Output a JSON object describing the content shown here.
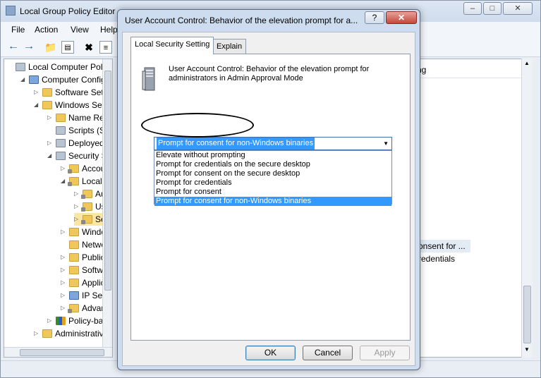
{
  "main_window": {
    "title": "Local Group Policy Editor",
    "menu": [
      "File",
      "Action",
      "View",
      "Help"
    ],
    "tree": [
      {
        "label": "Local Computer Polic",
        "icon": "computer-policy-icon",
        "indent": 0,
        "arrow": ""
      },
      {
        "label": "Computer Config",
        "icon": "computer-icon",
        "indent": 1,
        "arrow": "◢"
      },
      {
        "label": "Software Setti",
        "icon": "folder-icon",
        "indent": 2,
        "arrow": "▷"
      },
      {
        "label": "Windows Sett",
        "icon": "folder-icon",
        "indent": 2,
        "arrow": "◢"
      },
      {
        "label": "Name Res",
        "icon": "folder-icon",
        "indent": 3,
        "arrow": "▷"
      },
      {
        "label": "Scripts (Sta",
        "icon": "script-icon",
        "indent": 3,
        "arrow": ""
      },
      {
        "label": "Deployed",
        "icon": "printer-icon",
        "indent": 3,
        "arrow": "▷"
      },
      {
        "label": "Security Se",
        "icon": "security-icon",
        "indent": 3,
        "arrow": "◢"
      },
      {
        "label": "Accou",
        "icon": "lock-folder-icon",
        "indent": 4,
        "arrow": "▷"
      },
      {
        "label": "Local P",
        "icon": "lock-folder-icon",
        "indent": 4,
        "arrow": "◢"
      },
      {
        "label": "Au",
        "icon": "lock-folder-icon",
        "indent": 5,
        "arrow": "▷"
      },
      {
        "label": "Use",
        "icon": "lock-folder-icon",
        "indent": 5,
        "arrow": "▷"
      },
      {
        "label": "Sec",
        "icon": "lock-folder-icon",
        "indent": 5,
        "arrow": "▷"
      },
      {
        "label": "Windo",
        "icon": "folder-icon",
        "indent": 4,
        "arrow": "▷"
      },
      {
        "label": "Netwo",
        "icon": "folder-icon",
        "indent": 4,
        "arrow": ""
      },
      {
        "label": "Public",
        "icon": "folder-icon",
        "indent": 4,
        "arrow": "▷"
      },
      {
        "label": "Softwa",
        "icon": "folder-icon",
        "indent": 4,
        "arrow": "▷"
      },
      {
        "label": "Applic",
        "icon": "folder-icon",
        "indent": 4,
        "arrow": "▷"
      },
      {
        "label": "IP Secu",
        "icon": "ip-security-icon",
        "indent": 4,
        "arrow": "▷"
      },
      {
        "label": "Advan",
        "icon": "lock-folder-icon",
        "indent": 4,
        "arrow": "▷"
      },
      {
        "label": "Policy-bas",
        "icon": "chart-icon",
        "indent": 3,
        "arrow": "▷"
      },
      {
        "label": "Administrative",
        "icon": "folder-icon",
        "indent": 2,
        "arrow": "▷"
      }
    ],
    "list_header": "ng",
    "list_rows": [
      {
        "text": "onsent for ...",
        "highlight": true
      },
      {
        "text": "redentials",
        "highlight": false
      }
    ]
  },
  "dialog": {
    "title": "User Account Control: Behavior of the elevation prompt for a...",
    "help_label": "?",
    "close_label": "✕",
    "tabs": [
      "Local Security Setting",
      "Explain"
    ],
    "description": "User Account Control: Behavior of the elevation prompt for administrators in Admin Approval Mode",
    "select": {
      "value": "Prompt for consent for non-Windows binaries",
      "options": [
        "Elevate without prompting",
        "Prompt for credentials on the secure desktop",
        "Prompt for consent on the secure desktop",
        "Prompt for credentials",
        "Prompt for consent",
        "Prompt for consent for non-Windows binaries"
      ],
      "selected_index": 5
    },
    "buttons": {
      "ok": "OK",
      "cancel": "Cancel",
      "apply": "Apply"
    }
  },
  "colors": {
    "selection": "#3399ff",
    "dialog_frame": "#cddcee"
  }
}
